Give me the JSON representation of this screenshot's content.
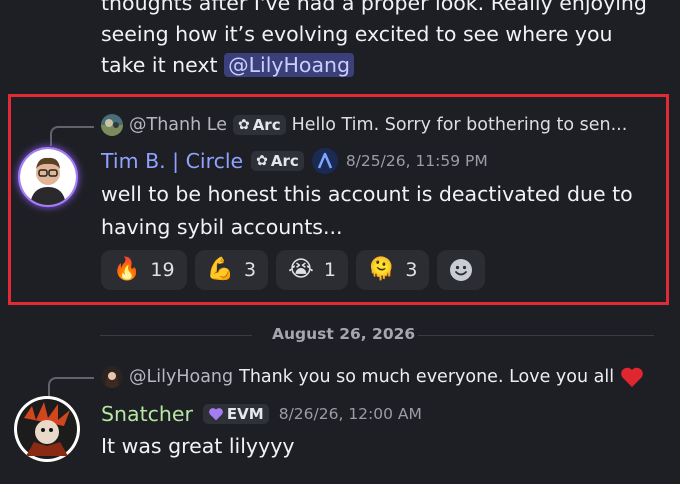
{
  "previous_message": {
    "line1": "thoughts after I've had a proper look. Really enjoying",
    "line2": "seeing how it’s evolving  excited to see where you",
    "line3_prefix": "take it next",
    "mention": "@LilyHoang"
  },
  "highlighted_message": {
    "reply": {
      "author": "@Thanh Le",
      "tag": "Arc",
      "preview": "Hello Tim. Sorry for bothering to sen..."
    },
    "author": "Tim B. | Circle",
    "author_color": "#8fa2ff",
    "tag": "Arc",
    "badge_icon": "arc-logo-icon",
    "timestamp": "8/25/26, 11:59 PM",
    "text_line1": "well to be honest this account is deactivated due to",
    "text_line2": "having sybil accounts...",
    "reactions": [
      {
        "emoji": "🔥",
        "count": "19",
        "icon": "fire-icon"
      },
      {
        "emoji": "💪",
        "count": "3",
        "icon": "flexed-biceps-icon"
      },
      {
        "emoji": "😭",
        "count": "1",
        "icon": "crying-face-icon"
      },
      {
        "emoji": "🫠",
        "count": "3",
        "icon": "melting-face-icon"
      }
    ],
    "add_reaction_icon": "add-reaction-icon",
    "highlight_color": "#e02a35"
  },
  "date_divider": "August 26, 2026",
  "next_message": {
    "reply": {
      "author": "@LilyHoang",
      "preview": "Thank you so much everyone. Love you all",
      "emoji": "❤️"
    },
    "author": "Snatcher",
    "author_color": "#b6e6a2",
    "tag": "EVM",
    "tag_icon": "purple-heart-icon",
    "timestamp": "8/26/26, 12:00 AM",
    "text": "It was great lilyyyy"
  }
}
